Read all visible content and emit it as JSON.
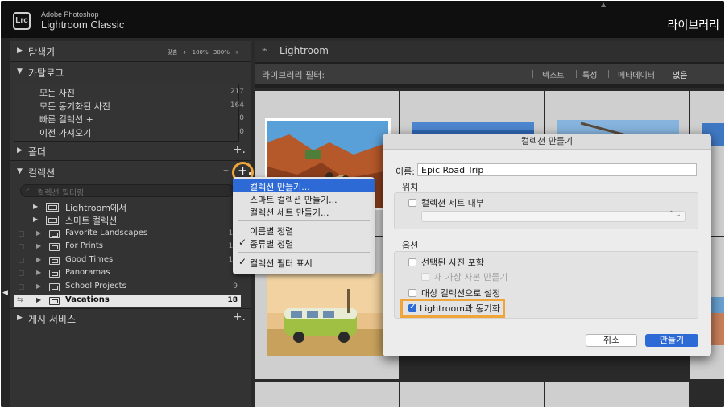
{
  "titlebar": {
    "logo": "Lrc",
    "brand_line1": "Adobe Photoshop",
    "brand_line2": "Lightroom Classic",
    "module": "라이브러리"
  },
  "left_panel": {
    "navigator": {
      "label": "탐색기",
      "zoom_options": "맞춤 ÷  100%  300% ÷"
    },
    "catalog": {
      "label": "카탈로그",
      "items": [
        {
          "label": "모든 사진",
          "count": "217"
        },
        {
          "label": "모든 동기화된 사진",
          "count": "164"
        },
        {
          "label": "빠른 컬렉션 +",
          "count": "0"
        },
        {
          "label": "이전 가져오기",
          "count": "0"
        }
      ]
    },
    "folders": {
      "label": "폴더"
    },
    "collections": {
      "label": "컬렉션",
      "filter_placeholder": "컬렉션 필터링",
      "groups": [
        {
          "label": "Lightroom에서"
        },
        {
          "label": "스마트 컬렉션"
        }
      ],
      "items": [
        {
          "label": "Favorite Landscapes",
          "count": "18"
        },
        {
          "label": "For Prints",
          "count": "19"
        },
        {
          "label": "Good Times",
          "count": "12"
        },
        {
          "label": "Panoramas",
          "count": "4"
        },
        {
          "label": "School Projects",
          "count": "9"
        },
        {
          "label": "Vacations",
          "count": "18"
        }
      ]
    },
    "publish": {
      "label": "게시 서비스"
    }
  },
  "context_menu": {
    "items": [
      {
        "label": "컬렉션 만들기..."
      },
      {
        "label": "스마트 컬렉션 만들기..."
      },
      {
        "label": "컬렉션 세트 만들기..."
      },
      {
        "label": "이름별 정렬"
      },
      {
        "label": "종류별 정렬"
      },
      {
        "label": "컬렉션 필터 표시"
      }
    ]
  },
  "main": {
    "tab_label": "Lightroom",
    "filter_label": "라이브러리 필터:",
    "filter_tabs": [
      "텍스트",
      "특성",
      "메타데이터",
      "없음"
    ]
  },
  "dialog": {
    "title": "컬렉션 만들기",
    "name_label": "이름:",
    "name_value": "Epic Road Trip",
    "location_label": "위치",
    "inside_set_label": "컬렉션 세트 내부",
    "options_label": "옵션",
    "include_selected_label": "선택된 사진 포함",
    "new_virtual_copies_label": "새 가상 사본 만들기",
    "set_as_target_label": "대상 컬렉션으로 설정",
    "sync_label": "Lightroom과 동기화",
    "cancel_label": "취소",
    "create_label": "만들기"
  },
  "colors": {
    "highlight_orange": "#f0a53a",
    "accent_blue": "#2d6ad6"
  }
}
